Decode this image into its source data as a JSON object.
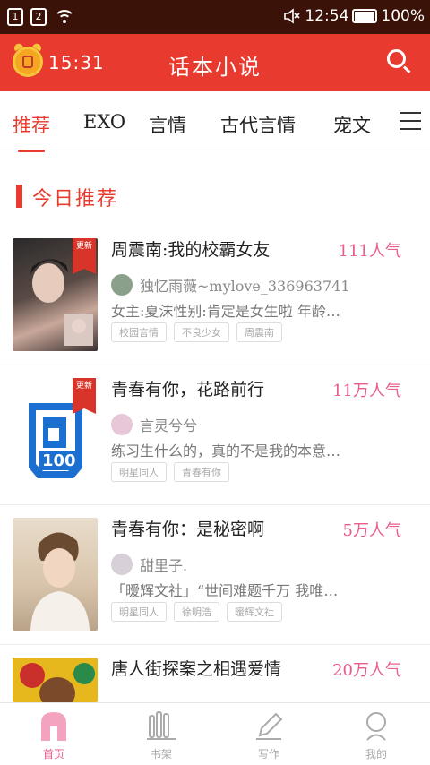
{
  "status": {
    "sim1": "1",
    "sim2": "2",
    "time": "12:54",
    "battery": "100%"
  },
  "header": {
    "clock": "15:31",
    "title": "话本小说"
  },
  "tabs": [
    "推荐",
    "EXO",
    "言情",
    "古代言情",
    "宠文"
  ],
  "section": {
    "title": "今日推荐"
  },
  "books": [
    {
      "title": "周震南:我的校霸女友",
      "popularity": "111人气",
      "author": "独忆雨薇~mylove_336963741",
      "desc": "女主:夏沫性别:肯定是女生啦 年龄…",
      "tags": [
        "校园言情",
        "不良少女",
        "周震南"
      ],
      "badge": "更新"
    },
    {
      "title": "青春有你，花路前行",
      "popularity": "11万人气",
      "author": "言灵兮兮",
      "desc": "练习生什么的，真的不是我的本意…",
      "tags": [
        "明星同人",
        "青春有你"
      ],
      "badge": "更新",
      "cover_text": "100"
    },
    {
      "title": "青春有你：是秘密啊",
      "popularity": "5万人气",
      "author": "甜里子.",
      "desc": "「暧辉文社」“世间难题千万 我唯…",
      "tags": [
        "明星同人",
        "徐明浩",
        "暧辉文社"
      ]
    },
    {
      "title": "唐人街探案之相遇爱情",
      "popularity": "20万人气"
    }
  ],
  "nav": [
    "首页",
    "书架",
    "写作",
    "我的"
  ],
  "colors": {
    "brand": "#e83a2e",
    "pink": "#e85d8a",
    "statusbar": "#3a1208"
  }
}
